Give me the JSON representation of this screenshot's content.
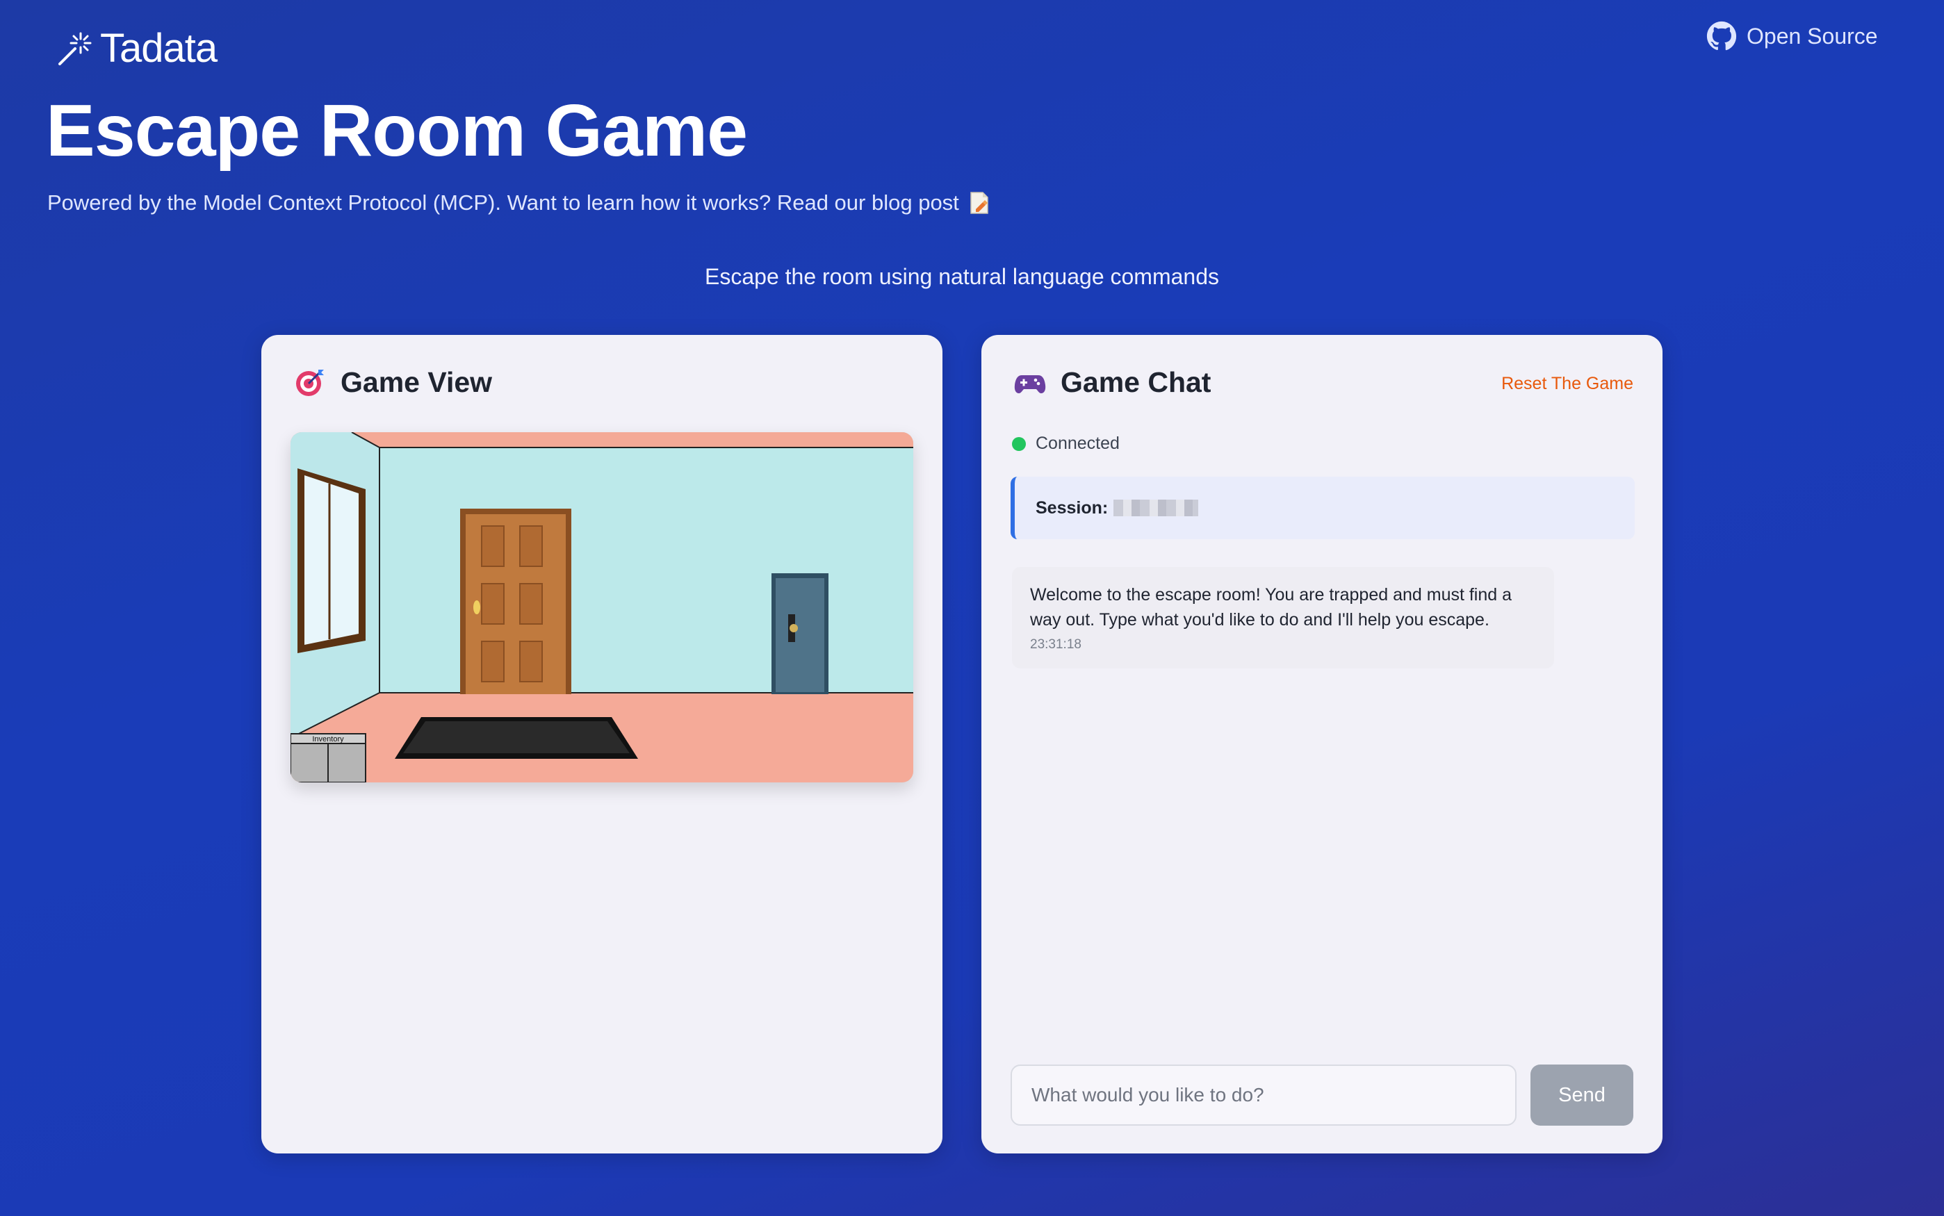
{
  "brand": {
    "name": "Tadata"
  },
  "header": {
    "open_source_label": "Open Source",
    "title": "Escape Room Game",
    "subtitle": "Powered by the Model Context Protocol (MCP). Want to learn how it works? Read our blog post",
    "tagline": "Escape the room using natural language commands"
  },
  "game_view": {
    "title": "Game View",
    "icon": "target-icon",
    "inventory_label": "Inventory"
  },
  "game_chat": {
    "title": "Game Chat",
    "icon": "gamepad-icon",
    "reset_label": "Reset The Game",
    "status": "Connected",
    "session_label": "Session:",
    "messages": [
      {
        "text": "Welcome to the escape room! You are trapped and must find a way out. Type what you'd like to do and I'll help you escape.",
        "time": "23:31:18"
      }
    ],
    "input_placeholder": "What would you like to do?",
    "send_label": "Send"
  },
  "colors": {
    "background": "#1d3aa6",
    "panel": "#f2f1f8",
    "accent_reset": "#e8590c",
    "status_connected": "#22c55e",
    "session_border": "#2f6fe4",
    "send_disabled": "#9ca3af"
  }
}
